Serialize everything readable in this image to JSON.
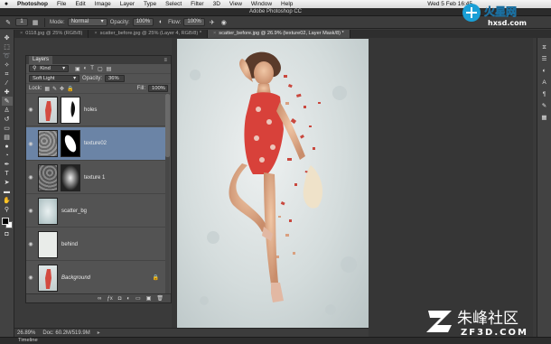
{
  "menubar": {
    "apple": "",
    "items": [
      "Photoshop",
      "File",
      "Edit",
      "Image",
      "Layer",
      "Type",
      "Select",
      "Filter",
      "3D",
      "View",
      "Window",
      "Help"
    ],
    "clock": "Wed 5 Feb 16:45"
  },
  "window": {
    "title": "Adobe Photoshop CC"
  },
  "options": {
    "mode_label": "Mode:",
    "mode_value": "Normal",
    "opacity_label": "Opacity:",
    "opacity_value": "100%",
    "flow_label": "Flow:",
    "flow_value": "100%",
    "brush_size": "1"
  },
  "doctabs": [
    {
      "label": "0118.jpg @ 25% (RGB/8)",
      "active": false
    },
    {
      "label": "scatter_before.jpg @ 25% (Layer 4, RGB/8) *",
      "active": false
    },
    {
      "label": "scatter_before.jpg @ 26.9% (texture02, Layer Mask/8) *",
      "active": true
    }
  ],
  "layers_panel": {
    "tab": "Layers",
    "kind_label": "Kind",
    "blend_mode": "Soft Light",
    "opacity_label": "Opacity:",
    "opacity_value": "36%",
    "lock_label": "Lock:",
    "fill_label": "Fill:",
    "fill_value": "100%",
    "layers": [
      {
        "name": "holes",
        "selected": false,
        "italic": false,
        "locked": false
      },
      {
        "name": "texture02",
        "selected": true,
        "italic": false,
        "locked": false
      },
      {
        "name": "texture 1",
        "selected": false,
        "italic": false,
        "locked": false
      },
      {
        "name": "scatter_bg",
        "selected": false,
        "italic": false,
        "locked": false
      },
      {
        "name": "behind",
        "selected": false,
        "italic": false,
        "locked": false
      },
      {
        "name": "Background",
        "selected": false,
        "italic": true,
        "locked": true
      }
    ],
    "footer_icons": [
      "link-icon",
      "fx-icon",
      "mask-icon",
      "adjustment-icon",
      "folder-icon",
      "new-layer-icon",
      "trash-icon"
    ]
  },
  "status": {
    "zoom": "26.89%",
    "doc": "Doc: 60.2M/519.9M"
  },
  "timeline": {
    "label": "Timeline"
  },
  "watermarks": {
    "top_text": "hxsd.com",
    "bottom_text": "ZF3D.COM",
    "bottom_cjk": "朱峰社区"
  }
}
